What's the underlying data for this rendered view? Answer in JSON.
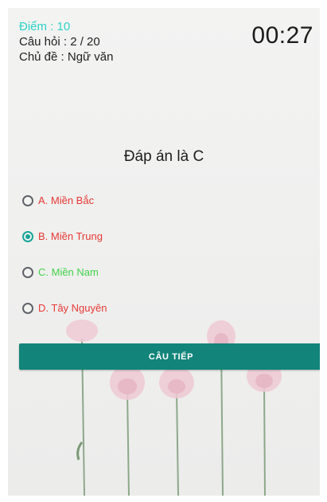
{
  "stats": {
    "score": "Điểm : 10",
    "question_count": "Câu hỏi : 2 / 20",
    "topic": "Chủ đề : Ngữ văn"
  },
  "timer": "00:27",
  "answer_message": "Đáp án là C",
  "options": [
    {
      "label": "A. Miền Bắc",
      "selected": false,
      "color": "#e53935"
    },
    {
      "label": "B. Miền Trung",
      "selected": true,
      "color": "#e53935"
    },
    {
      "label": "C. Miền Nam",
      "selected": false,
      "color": "#43d24a"
    },
    {
      "label": "D. Tây Nguyên",
      "selected": false,
      "color": "#e53935"
    }
  ],
  "next_button": {
    "label": "CÂU TIẾP"
  },
  "colors": {
    "accent": "#12847a",
    "score": "#2ed3c6",
    "wrong": "#e53935",
    "correct": "#43d24a"
  }
}
